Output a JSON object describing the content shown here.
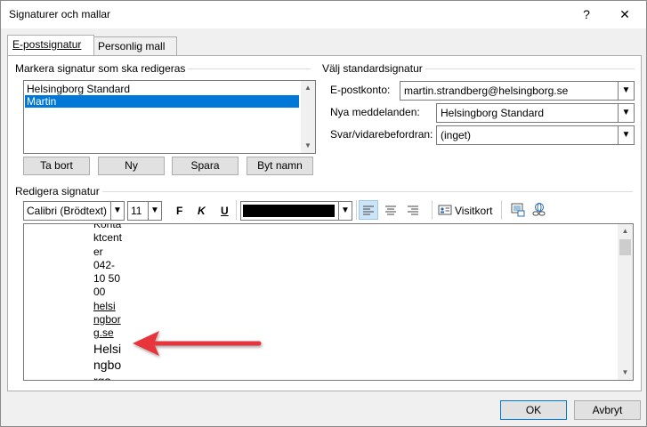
{
  "window": {
    "title": "Signaturer och mallar",
    "help_glyph": "?",
    "close_glyph": "✕"
  },
  "tabs": [
    {
      "label": "E-postsignatur"
    },
    {
      "label": "Personlig mall"
    }
  ],
  "edit_group": {
    "label": "Markera signatur som ska redigeras"
  },
  "signatures": [
    {
      "name": "Helsingborg Standard"
    },
    {
      "name": "Martin"
    }
  ],
  "list_buttons": {
    "delete": "Ta bort",
    "new": "Ny",
    "save": "Spara",
    "rename": "Byt namn"
  },
  "default_group": {
    "label": "Välj standardsignatur",
    "account_label": "E-postkonto:",
    "account_value": "martin.strandberg@helsingborg.se",
    "new_messages_label": "Nya meddelanden:",
    "new_messages_value": "Helsingborg Standard",
    "replies_label": "Svar/vidarebefordran:",
    "replies_value": "(inget)"
  },
  "editor_group": {
    "label": "Redigera signatur"
  },
  "toolbar": {
    "font_name": "Calibri (Brödtext)",
    "font_size": "11",
    "bold": "F",
    "italic": "K",
    "underline": "U",
    "font_color": "#000000",
    "business_card": "Visitkort"
  },
  "signature_lines": [
    "Kontaktcenter 042-10 50 00",
    "helsingborg.se",
    "Helsingborgs"
  ],
  "wrapped_lines": [
    "Konta",
    "ktcent",
    "er",
    "042-",
    "10 50",
    "00",
    "helsi",
    "ngbor",
    "g.se",
    "Helsi",
    "ngbo",
    "rgs"
  ],
  "footer": {
    "ok": "OK",
    "cancel": "Avbryt"
  },
  "colors": {
    "selection": "#0078d7",
    "arrow": "#e8353b"
  }
}
